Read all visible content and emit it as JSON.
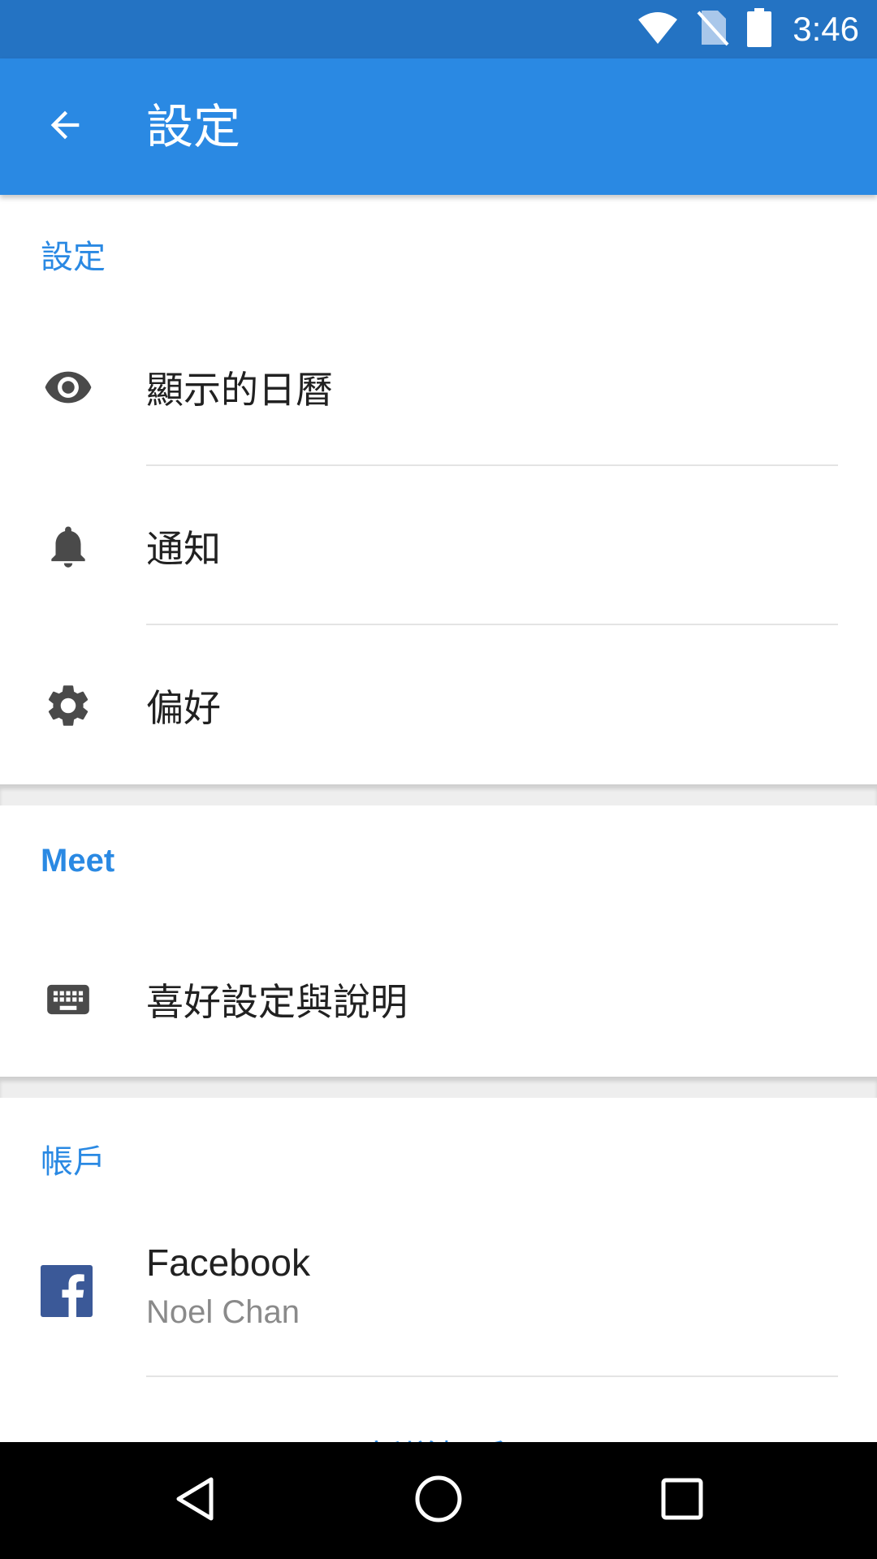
{
  "status_bar": {
    "time": "3:46",
    "icons": [
      "wifi-icon",
      "no-sim-icon",
      "battery-icon"
    ]
  },
  "app_bar": {
    "title": "設定",
    "back_icon": "arrow-back-icon"
  },
  "sections": {
    "settings": {
      "header": "設定",
      "items": [
        {
          "label": "顯示的日曆",
          "icon": "eye-icon"
        },
        {
          "label": "通知",
          "icon": "bell-icon"
        },
        {
          "label": "偏好",
          "icon": "gear-icon"
        }
      ]
    },
    "meet": {
      "header": "Meet",
      "items": [
        {
          "label": "喜好設定與說明",
          "icon": "keyboard-icon"
        }
      ]
    },
    "accounts": {
      "header": "帳戶",
      "items": [
        {
          "name": "Facebook",
          "sub": "Noel Chan",
          "icon": "facebook-icon"
        }
      ],
      "add_label": "新增帳戶"
    }
  },
  "nav_bar": {
    "buttons": [
      "back-nav-icon",
      "home-nav-icon",
      "recents-nav-icon"
    ]
  },
  "colors": {
    "status_bar": "#2473c3",
    "app_bar": "#2a89e3",
    "accent": "#2a89e3",
    "icon": "#4a4a4a",
    "facebook": "#3b5998"
  }
}
